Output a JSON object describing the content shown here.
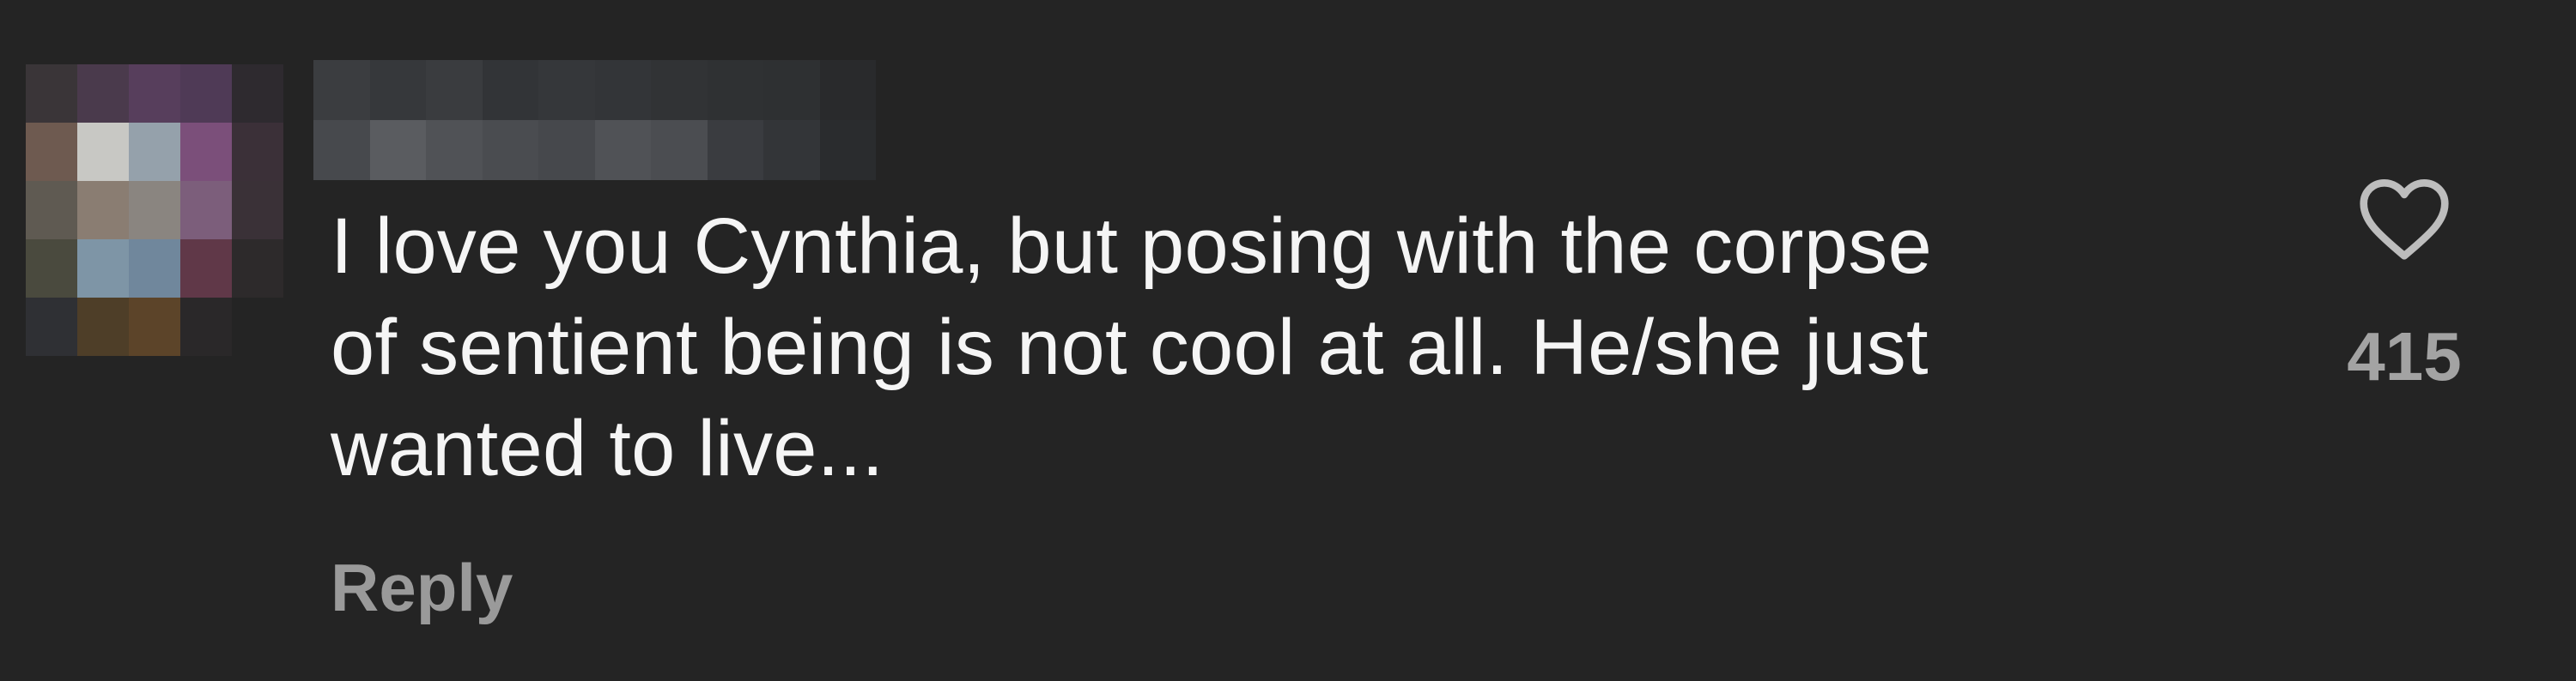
{
  "comment": {
    "text_lines": [
      "I love you Cynthia, but posing with the corpse",
      "of sentient being is not cool at all. He/she just",
      "wanted to live..."
    ],
    "reply_label": "Reply",
    "like_count": "415",
    "like_icon": "heart-outline-icon",
    "username_redacted": true,
    "avatar_redacted": true
  },
  "colors": {
    "background": "#242424",
    "text": "#f5f5f5",
    "secondary_text": "#9a9a9a"
  }
}
